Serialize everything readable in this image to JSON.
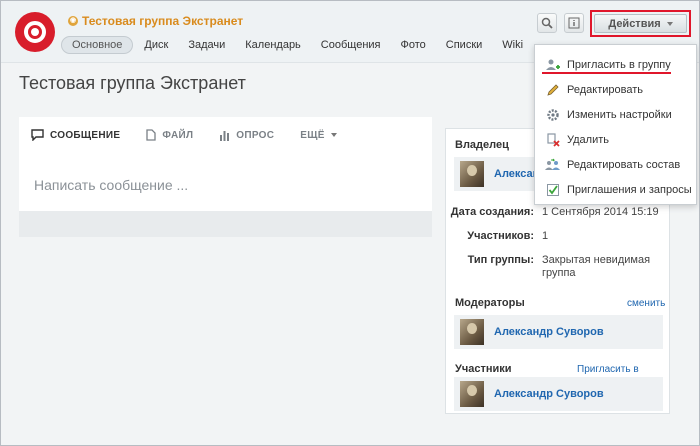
{
  "header": {
    "group_name": "Тестовая группа Экстранет",
    "nav": [
      "Основное",
      "Диск",
      "Задачи",
      "Календарь",
      "Сообщения",
      "Фото",
      "Списки",
      "Wiki"
    ],
    "actions_label": "Действия"
  },
  "page": {
    "title": "Тестовая группа Экстранет"
  },
  "composer": {
    "tabs": [
      "СООБЩЕНИЕ",
      "ФАЙЛ",
      "ОПРОС",
      "ЕЩЁ"
    ],
    "placeholder": "Написать сообщение ..."
  },
  "info": {
    "owner_title": "Владелец",
    "owner_name": "Александр Суворов",
    "created_label": "Дата создания:",
    "created_value": "1 Сентября 2014 15:19",
    "members_label": "Участников:",
    "members_value": "1",
    "type_label": "Тип группы:",
    "type_value": "Закрытая невидимая группа",
    "moderators_title": "Модераторы",
    "moderators_link": "сменить",
    "moderator_name": "Александр Суворов",
    "participants_title": "Участники",
    "participants_link": "Пригласить в группу",
    "participant_name": "Александр Суворов"
  },
  "menu": {
    "items": [
      "Пригласить в группу",
      "Редактировать",
      "Изменить настройки",
      "Удалить",
      "Редактировать состав",
      "Приглашения и запросы"
    ]
  },
  "colors": {
    "accent": "#2067b0",
    "group_link": "#d98b1d",
    "highlight": "#e0162b",
    "logo": "#d81d2b"
  }
}
